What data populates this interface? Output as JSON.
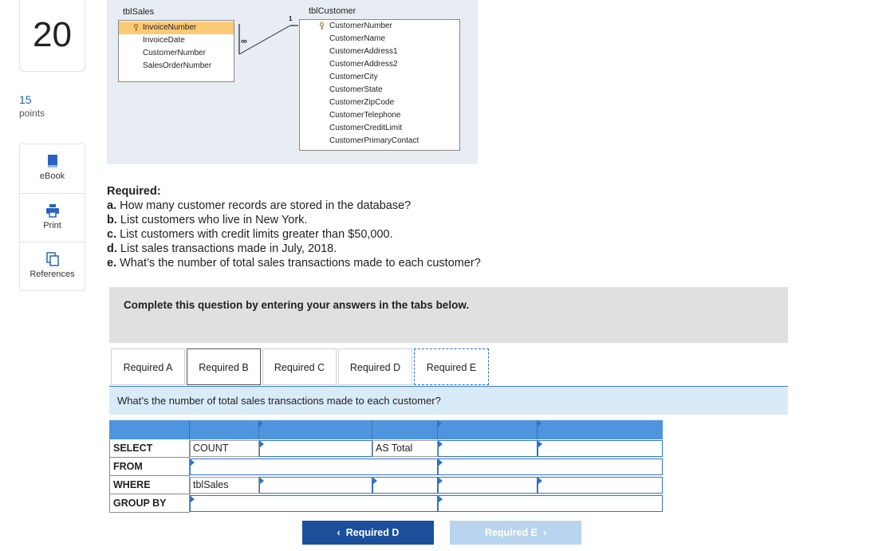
{
  "question": {
    "number": "20",
    "points_value": "15",
    "points_label": "points"
  },
  "tools": [
    {
      "label": "eBook"
    },
    {
      "label": "Print"
    },
    {
      "label": "References"
    }
  ],
  "diagram": {
    "sales": {
      "title": "tblSales",
      "fields": [
        "InvoiceNumber",
        "InvoiceDate",
        "CustomerNumber",
        "SalesOrderNumber"
      ]
    },
    "customer": {
      "title": "tblCustomer",
      "fields": [
        "CustomerNumber",
        "CustomerName",
        "CustomerAddress1",
        "CustomerAddress2",
        "CustomerCity",
        "CustomerState",
        "CustomerZipCode",
        "CustomerTelephone",
        "CustomerCreditLimit",
        "CustomerPrimaryContact"
      ]
    },
    "rel_one": "1",
    "rel_many": "∞"
  },
  "required": {
    "heading": "Required:",
    "items": [
      {
        "letter": "a.",
        "text": "How many customer records are stored in the database?"
      },
      {
        "letter": "b.",
        "text": "List customers who live in New York."
      },
      {
        "letter": "c.",
        "text": "List customers with credit limits greater than $50,000."
      },
      {
        "letter": "d.",
        "text": "List sales transactions made in July, 2018."
      },
      {
        "letter": "e.",
        "text": "What’s the number of total sales transactions made to each customer?"
      }
    ]
  },
  "banner": "Complete this question by entering your answers in the tabs below.",
  "tabs": [
    "Required A",
    "Required B",
    "Required C",
    "Required D",
    "Required E"
  ],
  "active_tab": "Required E",
  "prompt": "What’s the number of total sales transactions made to each customer?",
  "sql": {
    "rows": [
      {
        "label": "SELECT",
        "c1": "COUNT",
        "c3": "AS Total"
      },
      {
        "label": "FROM"
      },
      {
        "label": "WHERE",
        "c1": "tblSales"
      },
      {
        "label": "GROUP BY"
      }
    ]
  },
  "nav": {
    "prev": "Required D",
    "next": "Required E"
  },
  "colors": {
    "accent": "#1a4f9c",
    "key_highlight": "#fcc975",
    "grid_header": "#4e95de"
  }
}
